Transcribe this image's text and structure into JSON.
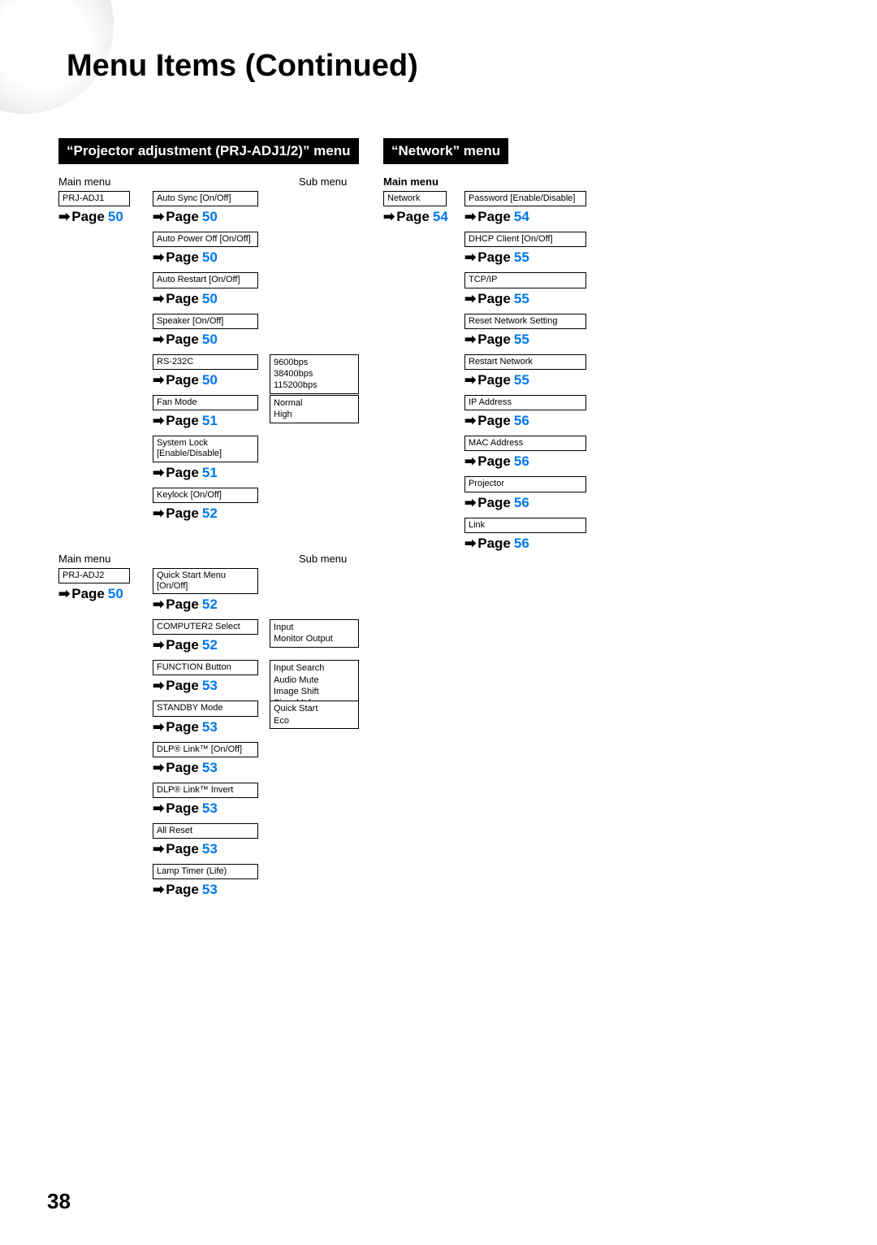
{
  "pageTitle": "Menu Items (Continued)",
  "pageNumber": "38",
  "sections": {
    "prj": {
      "header": "“Projector adjustment (PRJ-ADJ1/2)” menu",
      "mainLabel": "Main menu",
      "subLabel": "Sub menu",
      "adj1": {
        "root": "PRJ-ADJ1",
        "rootPage": "50",
        "items": [
          {
            "label": "Auto Sync [On/Off]",
            "page": "50"
          },
          {
            "label": "Auto Power Off [On/Off]",
            "page": "50"
          },
          {
            "label": "Auto Restart [On/Off]",
            "page": "50"
          },
          {
            "label": "Speaker [On/Off]",
            "page": "50"
          },
          {
            "label": "RS-232C",
            "page": "50",
            "sub": [
              "9600bps",
              "38400bps",
              "115200bps"
            ]
          },
          {
            "label": "Fan Mode",
            "page": "51",
            "sub": [
              "Normal",
              "High"
            ]
          },
          {
            "label": "System Lock\n[Enable/Disable]",
            "page": "51"
          },
          {
            "label": "Keylock [On/Off]",
            "page": "52"
          }
        ]
      },
      "adj2": {
        "root": "PRJ-ADJ2",
        "rootPage": "50",
        "items": [
          {
            "label": "Quick Start Menu [On/Off]",
            "page": "52"
          },
          {
            "label": "COMPUTER2 Select",
            "page": "52",
            "sub": [
              "Input",
              "Monitor Output"
            ]
          },
          {
            "label": "FUNCTION Button",
            "page": "53",
            "sub": [
              "Input Search",
              "Audio Mute",
              "Image Shift",
              "Signal Info"
            ]
          },
          {
            "label": "STANDBY Mode",
            "page": "53",
            "sub": [
              "Quick Start",
              "Eco"
            ]
          },
          {
            "label": "DLP® Link™ [On/Off]",
            "page": "53"
          },
          {
            "label": "DLP® Link™ Invert",
            "page": "53"
          },
          {
            "label": "All Reset",
            "page": "53"
          },
          {
            "label": "Lamp Timer (Life)",
            "page": "53"
          }
        ]
      }
    },
    "network": {
      "header": "“Network” menu",
      "mainLabel": "Main menu",
      "root": "Network",
      "rootPage": "54",
      "items": [
        {
          "label": "Password [Enable/Disable]",
          "page": "54"
        },
        {
          "label": "DHCP Client [On/Off]",
          "page": "55"
        },
        {
          "label": "TCP/IP",
          "page": "55"
        },
        {
          "label": "Reset Network Setting",
          "page": "55"
        },
        {
          "label": "Restart Network",
          "page": "55"
        },
        {
          "label": "IP Address",
          "page": "56"
        },
        {
          "label": "MAC Address",
          "page": "56"
        },
        {
          "label": "Projector",
          "page": "56"
        },
        {
          "label": "Link",
          "page": "56"
        }
      ]
    }
  },
  "ui": {
    "pageWord": "Page"
  }
}
